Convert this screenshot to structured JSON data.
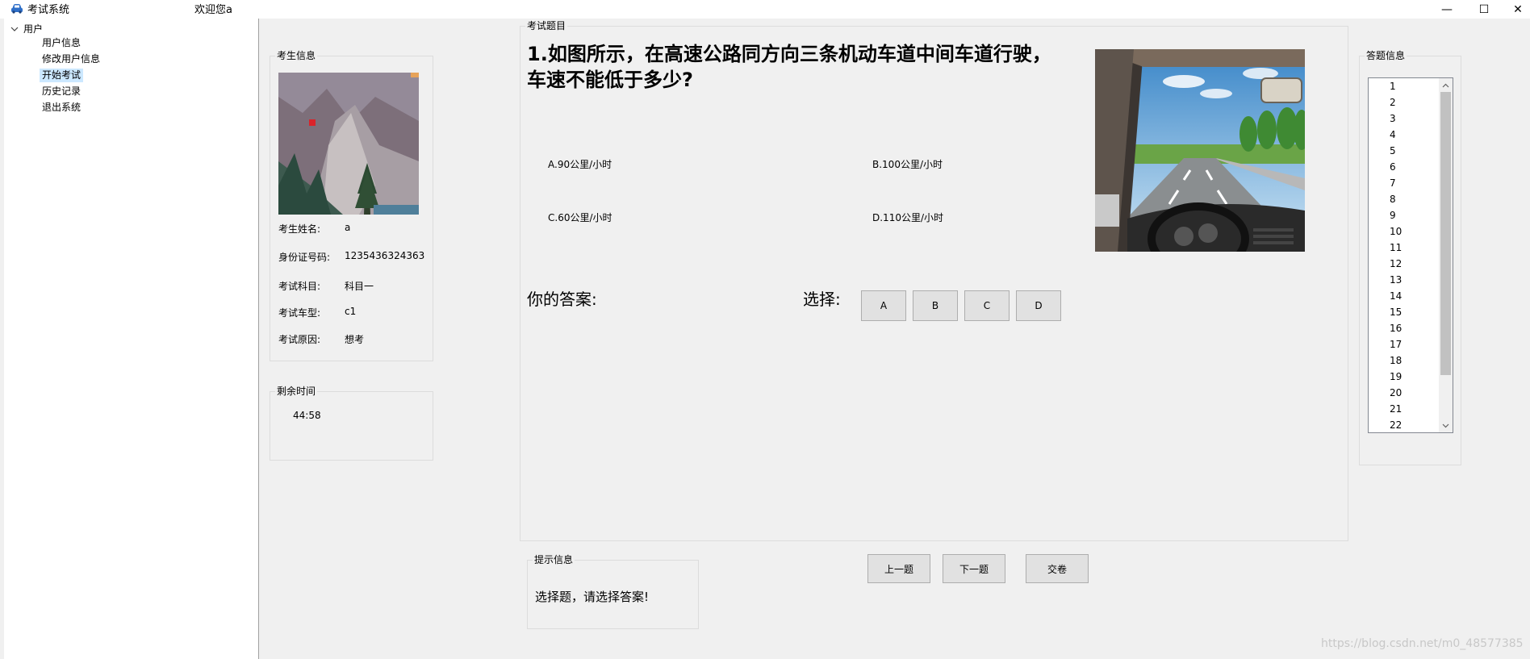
{
  "window": {
    "title": "考试系统",
    "welcome": "欢迎您a",
    "controls": {
      "minimize": "—",
      "maximize": "☐",
      "close": "✕"
    }
  },
  "tree": {
    "root": "用户",
    "items": [
      {
        "label": "用户信息",
        "selected": false
      },
      {
        "label": "修改用户信息",
        "selected": false
      },
      {
        "label": "开始考试",
        "selected": true
      },
      {
        "label": "历史记录",
        "selected": false
      },
      {
        "label": "退出系统",
        "selected": false
      }
    ]
  },
  "student": {
    "group_title": "考生信息",
    "fields": [
      {
        "label": "考生姓名:",
        "value": "a"
      },
      {
        "label": "身份证号码:",
        "value": "1235436324363"
      },
      {
        "label": "考试科目:",
        "value": "科目一"
      },
      {
        "label": "考试车型:",
        "value": "c1"
      },
      {
        "label": "考试原因:",
        "value": "想考"
      }
    ]
  },
  "timer": {
    "group_title": "剩余时间",
    "value": "44:58"
  },
  "question": {
    "group_title": "考试题目",
    "line1": "1.如图所示，在高速公路同方向三条机动车道中间车道行驶，",
    "line2": "车速不能低于多少?",
    "options": {
      "a": "A.90公里/小时",
      "b": "B.100公里/小时",
      "c": "C.60公里/小时",
      "d": "D.110公里/小时"
    }
  },
  "answer": {
    "your_answer_label": "你的答案:",
    "select_label": "选择:",
    "choices": [
      "A",
      "B",
      "C",
      "D"
    ]
  },
  "hint": {
    "group_title": "提示信息",
    "text": "选择题，请选择答案!"
  },
  "nav": {
    "prev": "上一题",
    "next": "下一题",
    "submit": "交卷"
  },
  "answer_sheet": {
    "group_title": "答题信息",
    "items": [
      "1",
      "2",
      "3",
      "4",
      "5",
      "6",
      "7",
      "8",
      "9",
      "10",
      "11",
      "12",
      "13",
      "14",
      "15",
      "16",
      "17",
      "18",
      "19",
      "20",
      "21",
      "22"
    ]
  },
  "watermark": "https://blog.csdn.net/m0_48577385",
  "colors": {
    "window_bg": "#f0f0f0",
    "tree_selected": "#cce8ff",
    "button_face": "#e1e1e1",
    "button_border": "#adadad"
  }
}
